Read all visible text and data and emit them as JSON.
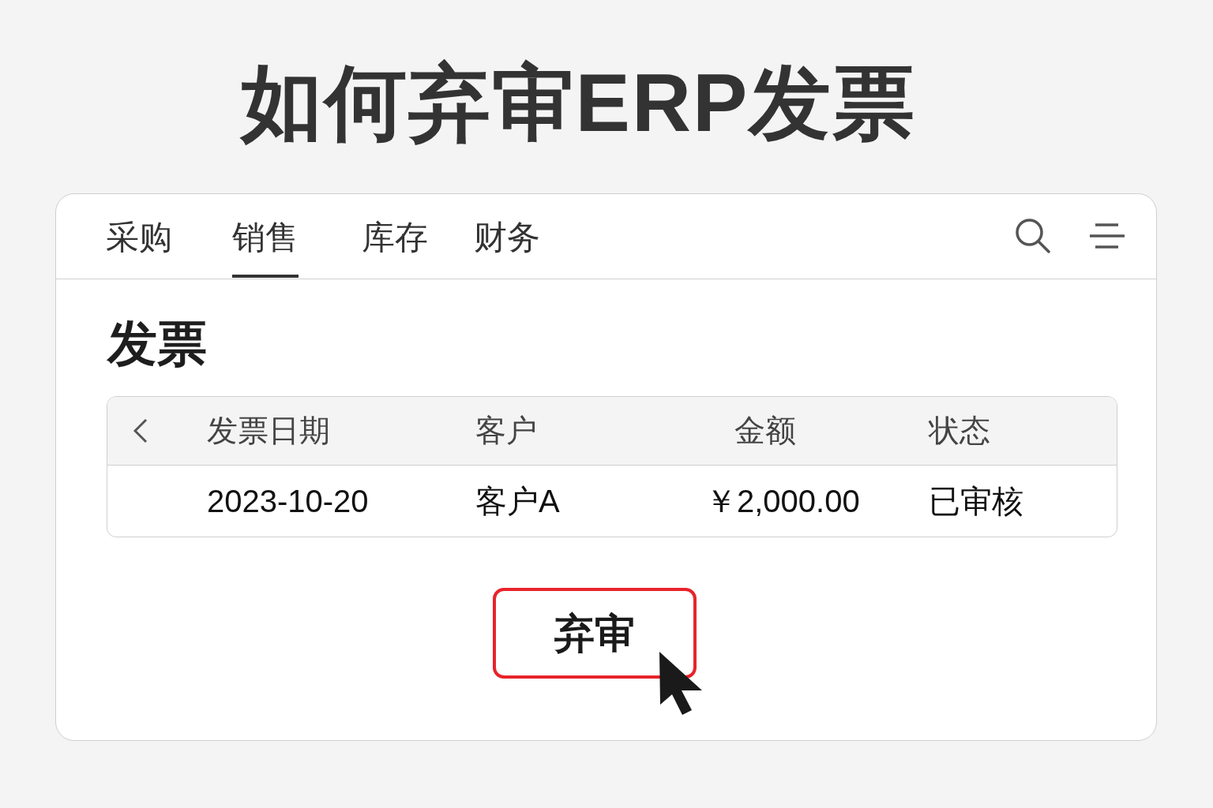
{
  "title": "如何弃审ERP发票",
  "card": {
    "tabs": [
      {
        "label": "采购",
        "selected": false
      },
      {
        "label": "销售",
        "selected": true
      },
      {
        "label": "库存",
        "selected": false
      },
      {
        "label": "财务",
        "selected": false
      }
    ],
    "heading": "发票",
    "table": {
      "columns": [
        "发票日期",
        "客户",
        "金额",
        "状态"
      ],
      "rows": [
        [
          "2023-10-20",
          "客户A",
          "￥2,000.00",
          "已审核"
        ]
      ]
    },
    "button": {
      "label": "弃审",
      "highlighted": true,
      "hovered": true
    }
  }
}
